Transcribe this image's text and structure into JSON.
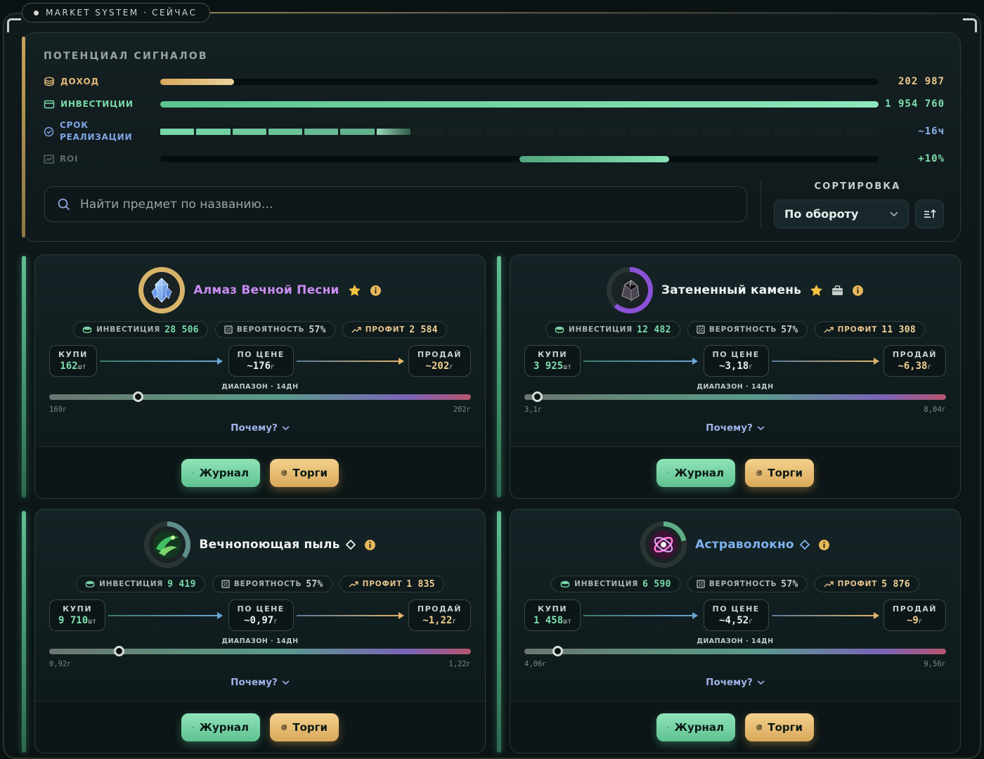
{
  "status_badge": "MARKET SYSTEM · СЕЙЧАС",
  "signals": {
    "title": "ПОТЕНЦИАЛ СИГНАЛОВ",
    "metrics": [
      {
        "label": "ДОХОД",
        "value": "202 987",
        "fill": 0.1,
        "color": "#e3b978",
        "icon": "coins-icon"
      },
      {
        "label": "ИНВЕСТИЦИИ",
        "value": "1 954 760",
        "fill": 1.0,
        "color": "#6fd7a3",
        "icon": "wallet-icon"
      },
      {
        "label": "СРОК РЕАЛИЗАЦИИ",
        "value": "~16ч",
        "fill": 0.35,
        "color": "#6fd7a3",
        "icon": "clock-icon"
      },
      {
        "label": "ROI",
        "value": "+10%",
        "fill_from": 0.5,
        "fill_to": 0.71,
        "color": "#6fd7a3",
        "icon": "chart-icon"
      }
    ]
  },
  "search": {
    "placeholder": "Найти предмет по названию…"
  },
  "sort": {
    "label": "СОРТИРОВКА",
    "selected": "По обороту"
  },
  "labels": {
    "invest": "ИНВЕСТИЦИЯ",
    "prob": "ВЕРОЯТНОСТЬ",
    "profit": "ПРОФИТ",
    "buy": "КУПИ",
    "at_price": "ПО ЦЕНЕ",
    "sell": "ПРОДАЙ",
    "range": "ДИАПАЗОН · 14ДН",
    "why": "Почему?",
    "journal": "Журнал",
    "trade": "Торги",
    "qty_unit": "шт",
    "price_unit": "г"
  },
  "cards": [
    {
      "name": "Алмаз Вечной Песни",
      "name_color": "#c98cf2",
      "starred": true,
      "marker": "",
      "ring_color": "#d7b46a",
      "ring_progress": 1.0,
      "icon": "crystal-icon",
      "invest": "28 506",
      "prob": "57%",
      "profit": "2 584",
      "buy_qty": "162",
      "price": "~176",
      "sell": "~202",
      "min": "169г",
      "max": "202г",
      "knob": 0.21
    },
    {
      "name": "Затененный камень",
      "name_color": "#eef2f0",
      "starred": true,
      "marker": "bag",
      "ring_color": "#8b52d6",
      "ring_progress": 0.62,
      "icon": "stone-icon",
      "invest": "12 482",
      "prob": "57%",
      "profit": "11 308",
      "buy_qty": "3 925",
      "price": "~3,18",
      "sell": "~6,38",
      "min": "3,1г",
      "max": "8,04г",
      "knob": 0.03
    },
    {
      "name": "Вечнопоющая пыль",
      "name_color": "#eef2f0",
      "starred": false,
      "marker": "diamond",
      "ring_color": "#5f8e8c",
      "ring_progress": 0.35,
      "icon": "dust-icon",
      "invest": "9 419",
      "prob": "57%",
      "profit": "1 835",
      "buy_qty": "9 710",
      "price": "~0,97",
      "sell": "~1,22",
      "min": "0,92г",
      "max": "1,22г",
      "knob": 0.165
    },
    {
      "name": "Астраволокно",
      "name_color": "#7fb2ee",
      "starred": false,
      "marker": "diamond",
      "ring_color": "#5fae85",
      "ring_progress": 0.22,
      "icon": "fiber-icon",
      "invest": "6 590",
      "prob": "57%",
      "profit": "5 876",
      "buy_qty": "1 458",
      "price": "~4,52",
      "sell": "~9",
      "min": "4,06г",
      "max": "9,56г",
      "knob": 0.078
    }
  ]
}
